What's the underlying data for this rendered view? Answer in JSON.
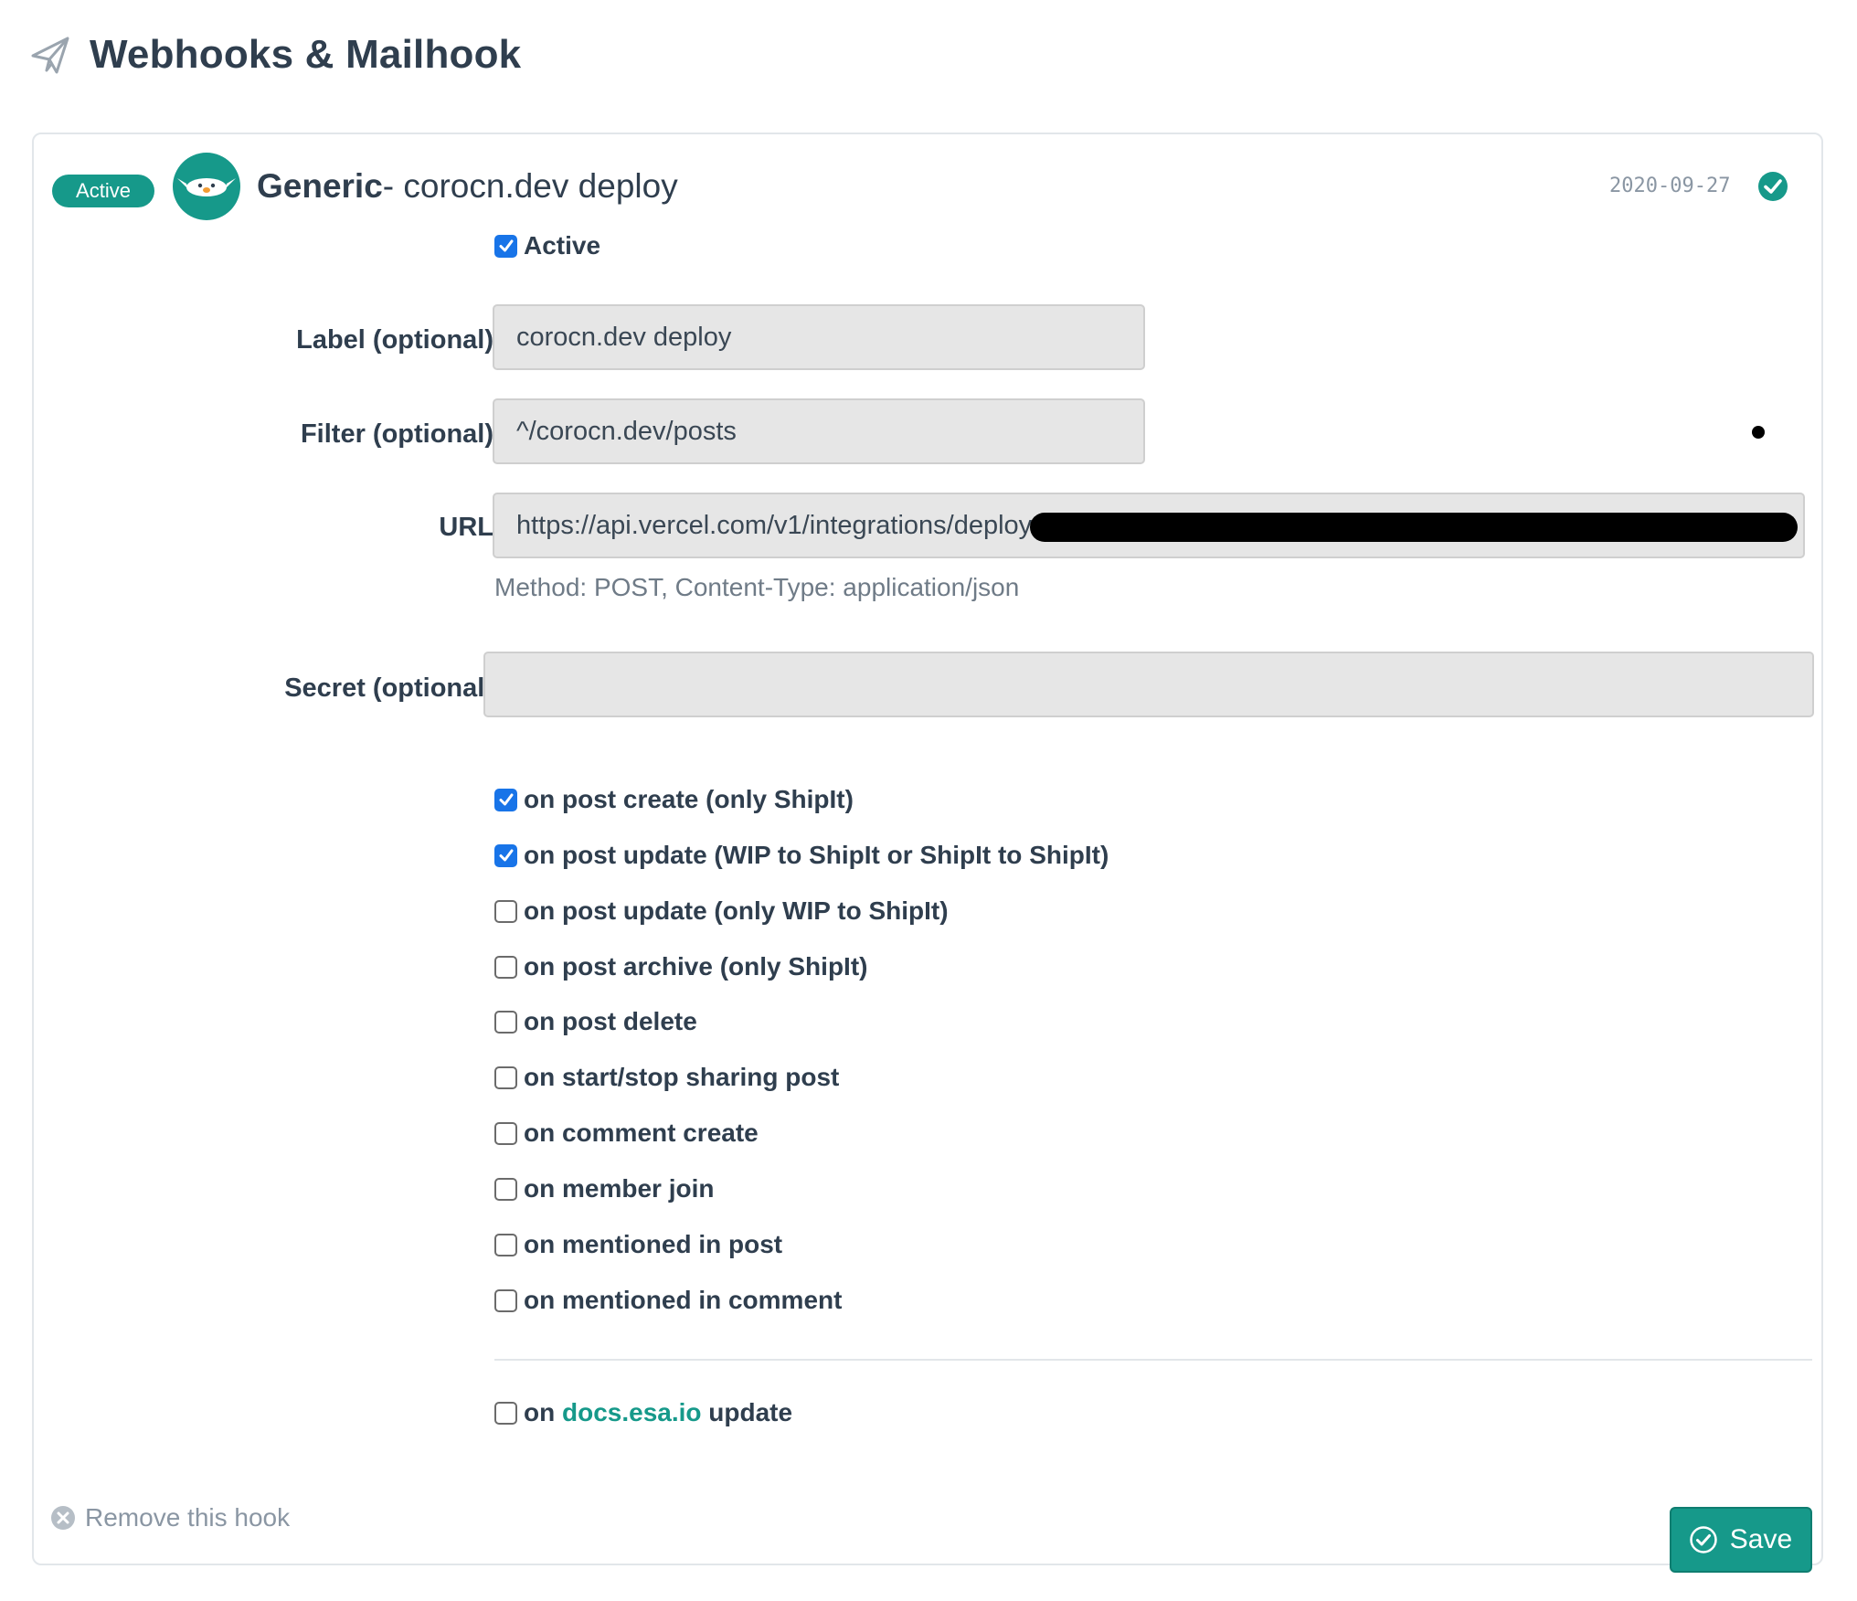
{
  "page": {
    "title": "Webhooks & Mailhook",
    "icon": "paper-plane-icon"
  },
  "hook": {
    "status_badge": "Active",
    "title_strong": "Generic",
    "title_rest": "- corocn.dev deploy",
    "date": "2020-09-27",
    "status_icon": "check-circle-icon",
    "avatar_icon": "bird-icon",
    "active_checkbox": {
      "label": "Active",
      "checked": true
    }
  },
  "form": {
    "label": {
      "label": "Label (optional)",
      "value": "corocn.dev deploy"
    },
    "filter": {
      "label": "Filter (optional)",
      "value": "^/corocn.dev/posts"
    },
    "url": {
      "label": "URL",
      "value": "https://api.vercel.com/v1/integrations/deploy/",
      "help": "Method: POST, Content-Type: application/json"
    },
    "secret": {
      "label": "Secret (optional)",
      "value": ""
    }
  },
  "events": [
    {
      "label": "on post create (only ShipIt)",
      "checked": true
    },
    {
      "label": "on post update (WIP to ShipIt or ShipIt to ShipIt)",
      "checked": true
    },
    {
      "label": "on post update (only WIP to ShipIt)",
      "checked": false
    },
    {
      "label": "on post archive (only ShipIt)",
      "checked": false
    },
    {
      "label": "on post delete",
      "checked": false
    },
    {
      "label": "on start/stop sharing post",
      "checked": false
    },
    {
      "label": "on comment create",
      "checked": false
    },
    {
      "label": "on member join",
      "checked": false
    },
    {
      "label": "on mentioned in post",
      "checked": false
    },
    {
      "label": "on mentioned in comment",
      "checked": false
    }
  ],
  "docs_event": {
    "prefix": "on",
    "link": "docs.esa.io",
    "suffix": "update",
    "checked": false
  },
  "footer": {
    "remove_label": "Remove this hook",
    "save_label": "Save"
  },
  "colors": {
    "accent": "#16998a",
    "checkbox": "#1874e8"
  }
}
